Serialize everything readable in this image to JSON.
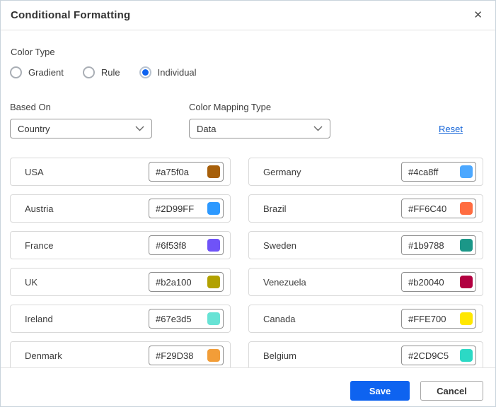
{
  "dialog": {
    "title": "Conditional Formatting",
    "close_glyph": "✕"
  },
  "color_type": {
    "label": "Color Type",
    "options": [
      {
        "label": "Gradient",
        "selected": false
      },
      {
        "label": "Rule",
        "selected": false
      },
      {
        "label": "Individual",
        "selected": true
      }
    ]
  },
  "based_on": {
    "label": "Based On",
    "value": "Country"
  },
  "color_mapping_type": {
    "label": "Color Mapping Type",
    "value": "Data"
  },
  "reset_label": "Reset",
  "countries": [
    {
      "name": "USA",
      "value": "#a75f0a"
    },
    {
      "name": "Germany",
      "value": "#4ca8ff"
    },
    {
      "name": "Austria",
      "value": "#2D99FF"
    },
    {
      "name": "Brazil",
      "value": "#FF6C40"
    },
    {
      "name": "France",
      "value": "#6f53f8"
    },
    {
      "name": "Sweden",
      "value": "#1b9788"
    },
    {
      "name": "UK",
      "value": "#b2a100"
    },
    {
      "name": "Venezuela",
      "value": "#b20040"
    },
    {
      "name": "Ireland",
      "value": "#67e3d5"
    },
    {
      "name": "Canada",
      "value": "#FFE700"
    },
    {
      "name": "Denmark",
      "value": "#F29D38"
    },
    {
      "name": "Belgium",
      "value": "#2CD9C5"
    }
  ],
  "footer": {
    "save_label": "Save",
    "cancel_label": "Cancel"
  },
  "colors": {
    "primary": "#0e63f0",
    "link": "#1565d8"
  }
}
